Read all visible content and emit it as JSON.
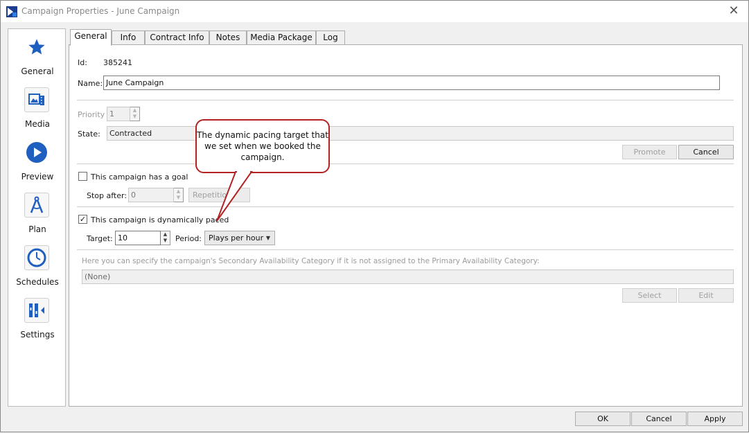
{
  "window": {
    "title": "Campaign Properties - June Campaign",
    "close_glyph": "✕"
  },
  "sidebar": {
    "items": [
      {
        "label": "General",
        "icon": "star-icon"
      },
      {
        "label": "Media",
        "icon": "media-icon"
      },
      {
        "label": "Preview",
        "icon": "play-icon"
      },
      {
        "label": "Plan",
        "icon": "compass-icon"
      },
      {
        "label": "Schedules",
        "icon": "clock-icon"
      },
      {
        "label": "Settings",
        "icon": "settings-icon"
      }
    ]
  },
  "tabs": [
    "General",
    "Info",
    "Contract Info",
    "Notes",
    "Media Package",
    "Log"
  ],
  "general": {
    "id_label": "Id:",
    "id_value": "385241",
    "name_label": "Name:",
    "name_value": "June Campaign",
    "priority_label": "Priority",
    "priority_value": "1",
    "state_label": "State:",
    "state_value": "Contracted",
    "promote_label": "Promote",
    "cancel_state_label": "Cancel",
    "goal_checkbox_label": "This campaign has a goal",
    "goal_checked": false,
    "stop_after_label": "Stop after:",
    "stop_after_value": "0",
    "repetitions_label": "Repetitions",
    "paced_checkbox_label": "This campaign is dynamically paced",
    "paced_checked": true,
    "check_glyph": "✓",
    "target_label": "Target:",
    "target_value": "10",
    "period_label": "Period:",
    "period_value": "Plays per hour",
    "secondary_hint": "Here you can specify the campaign's Secondary Availability Category if it is not assigned to the Primary Availability Category:",
    "secondary_value": "(None)",
    "select_label": "Select",
    "edit_label": "Edit"
  },
  "callout": {
    "text": "The dynamic pacing target that we set when we booked the campaign."
  },
  "footer": {
    "ok_label": "OK",
    "cancel_label": "Cancel",
    "apply_label": "Apply"
  },
  "colors": {
    "accent_blue": "#1f5fbf",
    "callout_border": "#b22222"
  }
}
